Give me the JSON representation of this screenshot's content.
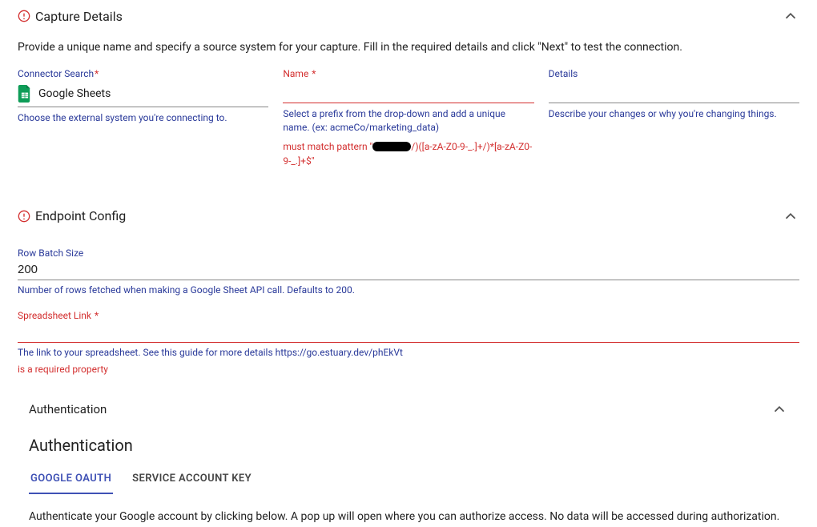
{
  "capture": {
    "title": "Capture Details",
    "description": "Provide a unique name and specify a source system for your capture. Fill in the required details and click \"Next\" to test the connection.",
    "connector": {
      "label": "Connector Search",
      "value": "Google Sheets",
      "helper": "Choose the external system you're connecting to."
    },
    "name": {
      "label": "Name",
      "value": "",
      "helper": "Select a prefix from the drop-down and add a unique name. (ex: acmeCo/marketing_data)",
      "error_prefix": "must match pattern \"",
      "error_suffix": "/)([a-zA-Z0-9-_.]+/)*[a-zA-Z0-9-_.]+$\""
    },
    "details": {
      "label": "Details",
      "value": "",
      "helper": "Describe your changes or why you're changing things."
    }
  },
  "endpoint": {
    "title": "Endpoint Config",
    "rowBatch": {
      "label": "Row Batch Size",
      "value": "200",
      "helper": "Number of rows fetched when making a Google Sheet API call. Defaults to 200."
    },
    "spreadsheet": {
      "label": "Spreadsheet Link",
      "helper": "The link to your spreadsheet. See this guide for more details https://go.estuary.dev/phEkVt",
      "error": "is a required property"
    }
  },
  "auth": {
    "accordion_title": "Authentication",
    "heading": "Authentication",
    "tabs": [
      "GOOGLE OAUTH",
      "SERVICE ACCOUNT KEY"
    ],
    "active_tab": 0,
    "description": "Authenticate your Google account by clicking below. A pop up will open where you can authorize access. No data will be accessed during authorization."
  }
}
